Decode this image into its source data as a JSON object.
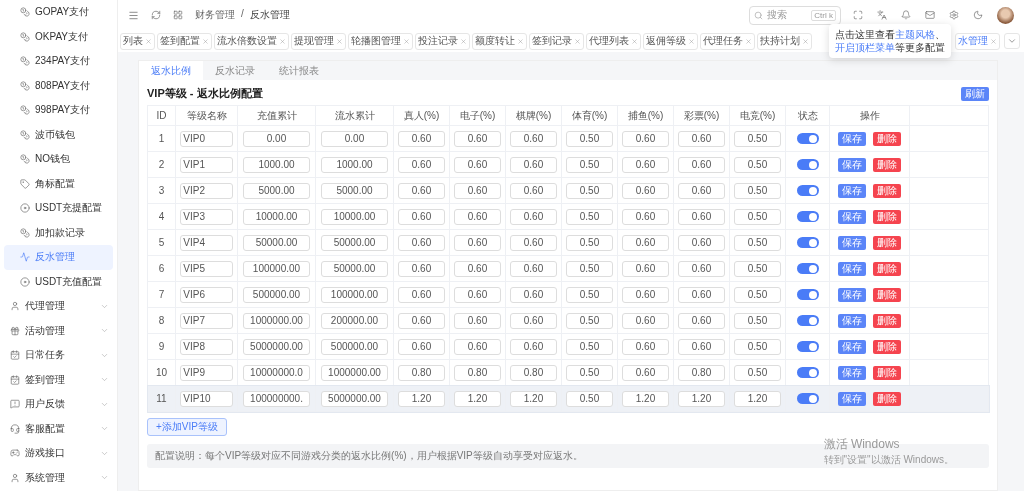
{
  "sidebar": {
    "items": [
      {
        "label": "GOPAY支付",
        "kind": "coin",
        "selected": false,
        "expandable": false
      },
      {
        "label": "OKPAY支付",
        "kind": "coin",
        "selected": false,
        "expandable": false
      },
      {
        "label": "234PAY支付",
        "kind": "coin",
        "selected": false,
        "expandable": false
      },
      {
        "label": "808PAY支付",
        "kind": "coin",
        "selected": false,
        "expandable": false
      },
      {
        "label": "998PAY支付",
        "kind": "coin",
        "selected": false,
        "expandable": false
      },
      {
        "label": "波币钱包",
        "kind": "coin",
        "selected": false,
        "expandable": false
      },
      {
        "label": "NO钱包",
        "kind": "coin",
        "selected": false,
        "expandable": false
      },
      {
        "label": "角标配置",
        "kind": "tag",
        "selected": false,
        "expandable": false
      },
      {
        "label": "USDT充提配置",
        "kind": "disc",
        "selected": false,
        "expandable": false
      },
      {
        "label": "加扣款记录",
        "kind": "coin",
        "selected": false,
        "expandable": false
      },
      {
        "label": "反水管理",
        "kind": "chart",
        "selected": true,
        "expandable": false
      },
      {
        "label": "USDT充值配置",
        "kind": "disc",
        "selected": false,
        "expandable": false
      },
      {
        "label": "代理管理",
        "kind": "user",
        "selected": false,
        "expandable": true
      },
      {
        "label": "活动管理",
        "kind": "gift",
        "selected": false,
        "expandable": true
      },
      {
        "label": "日常任务",
        "kind": "calendar",
        "selected": false,
        "expandable": true
      },
      {
        "label": "签到管理",
        "kind": "calendar",
        "selected": false,
        "expandable": true
      },
      {
        "label": "用户反馈",
        "kind": "message",
        "selected": false,
        "expandable": true
      },
      {
        "label": "客服配置",
        "kind": "headset",
        "selected": false,
        "expandable": true
      },
      {
        "label": "游戏接口",
        "kind": "gamepad",
        "selected": false,
        "expandable": true
      },
      {
        "label": "系统管理",
        "kind": "user",
        "selected": false,
        "expandable": true
      }
    ]
  },
  "header": {
    "breadcrumb": [
      "财务管理",
      "/",
      "反水管理"
    ],
    "search": {
      "placeholder": "搜索",
      "shortcut": "Ctrl k"
    }
  },
  "open_tabs": [
    {
      "label": "列表",
      "selected": false
    },
    {
      "label": "签到配置",
      "selected": false
    },
    {
      "label": "流水倍数设置",
      "selected": false
    },
    {
      "label": "提现管理",
      "selected": false
    },
    {
      "label": "轮播图管理",
      "selected": false
    },
    {
      "label": "投注记录",
      "selected": false
    },
    {
      "label": "额度转让",
      "selected": false
    },
    {
      "label": "签到记录",
      "selected": false
    },
    {
      "label": "代理列表",
      "selected": false
    },
    {
      "label": "返佣等级",
      "selected": false
    },
    {
      "label": "代理任务",
      "selected": false
    },
    {
      "label": "扶持计划",
      "selected": false
    },
    {
      "label": "水管理",
      "selected": true
    }
  ],
  "tooltip": {
    "lines": [
      [
        {
          "text": "点击这里查看",
          "link": false
        },
        {
          "text": "主题风格",
          "link": true
        },
        {
          "text": "、",
          "link": false
        }
      ],
      [
        {
          "text": "开启顶栏菜单",
          "link": true
        },
        {
          "text": "等更多配置",
          "link": false
        }
      ]
    ]
  },
  "page_tabs": [
    {
      "label": "返水比例",
      "selected": true
    },
    {
      "label": "反水记录",
      "selected": false
    },
    {
      "label": "统计报表",
      "selected": false
    }
  ],
  "section_title": "VIP等级 - 返水比例配置",
  "refresh_button": "刷新",
  "table": {
    "columns": [
      "ID",
      "等级名称",
      "充值累计",
      "流水累计",
      "真人(%)",
      "电子(%)",
      "棋牌(%)",
      "体育(%)",
      "捕鱼(%)",
      "彩票(%)",
      "电竞(%)",
      "状态",
      "操作"
    ],
    "rows": [
      {
        "id": "1",
        "name": "VIP0",
        "values": [
          "0.00",
          "0.00",
          "0.60",
          "0.60",
          "0.60",
          "0.50",
          "0.60",
          "0.60",
          "0.50"
        ],
        "on": true,
        "highlighted": false,
        "actions": [
          "保存",
          "删除"
        ]
      },
      {
        "id": "2",
        "name": "VIP1",
        "values": [
          "1000.00",
          "1000.00",
          "0.60",
          "0.60",
          "0.60",
          "0.50",
          "0.60",
          "0.60",
          "0.50"
        ],
        "on": true,
        "highlighted": false,
        "actions": [
          "保存",
          "删除"
        ]
      },
      {
        "id": "3",
        "name": "VIP2",
        "values": [
          "5000.00",
          "5000.00",
          "0.60",
          "0.60",
          "0.60",
          "0.50",
          "0.60",
          "0.60",
          "0.50"
        ],
        "on": true,
        "highlighted": false,
        "actions": [
          "保存",
          "删除"
        ]
      },
      {
        "id": "4",
        "name": "VIP3",
        "values": [
          "10000.00",
          "10000.00",
          "0.60",
          "0.60",
          "0.60",
          "0.50",
          "0.60",
          "0.60",
          "0.50"
        ],
        "on": true,
        "highlighted": false,
        "actions": [
          "保存",
          "删除"
        ]
      },
      {
        "id": "5",
        "name": "VIP4",
        "values": [
          "50000.00",
          "50000.00",
          "0.60",
          "0.60",
          "0.60",
          "0.50",
          "0.60",
          "0.60",
          "0.50"
        ],
        "on": true,
        "highlighted": false,
        "actions": [
          "保存",
          "删除"
        ]
      },
      {
        "id": "6",
        "name": "VIP5",
        "values": [
          "100000.00",
          "50000.00",
          "0.60",
          "0.60",
          "0.60",
          "0.50",
          "0.60",
          "0.60",
          "0.50"
        ],
        "on": true,
        "highlighted": false,
        "actions": [
          "保存",
          "删除"
        ]
      },
      {
        "id": "7",
        "name": "VIP6",
        "values": [
          "500000.00",
          "100000.00",
          "0.60",
          "0.60",
          "0.60",
          "0.50",
          "0.60",
          "0.60",
          "0.50"
        ],
        "on": true,
        "highlighted": false,
        "actions": [
          "保存",
          "删除"
        ]
      },
      {
        "id": "8",
        "name": "VIP7",
        "values": [
          "1000000.00",
          "200000.00",
          "0.60",
          "0.60",
          "0.60",
          "0.50",
          "0.60",
          "0.60",
          "0.50"
        ],
        "on": true,
        "highlighted": false,
        "actions": [
          "保存",
          "删除"
        ]
      },
      {
        "id": "9",
        "name": "VIP8",
        "values": [
          "5000000.00",
          "500000.00",
          "0.60",
          "0.60",
          "0.60",
          "0.50",
          "0.60",
          "0.60",
          "0.50"
        ],
        "on": true,
        "highlighted": false,
        "actions": [
          "保存",
          "删除"
        ]
      },
      {
        "id": "10",
        "name": "VIP9",
        "values": [
          "10000000.0",
          "1000000.00",
          "0.80",
          "0.80",
          "0.80",
          "0.50",
          "0.60",
          "0.80",
          "0.50"
        ],
        "on": true,
        "highlighted": false,
        "actions": [
          "保存",
          "删除"
        ]
      },
      {
        "id": "11",
        "name": "VIP10",
        "values": [
          "100000000.",
          "5000000.00",
          "1.20",
          "1.20",
          "1.20",
          "0.50",
          "1.20",
          "1.20",
          "1.20"
        ],
        "on": true,
        "highlighted": true,
        "actions": [
          "保存",
          "删除"
        ]
      }
    ]
  },
  "add_button": "+添加VIP等级",
  "note": "配置说明：每个VIP等级对应不同游戏分类的返水比例(%)，用户根据VIP等级自动享受对应返水。",
  "os_notice": {
    "title": "激活 Windows",
    "subtitle": "转到\"设置\"以激活 Windows。"
  }
}
